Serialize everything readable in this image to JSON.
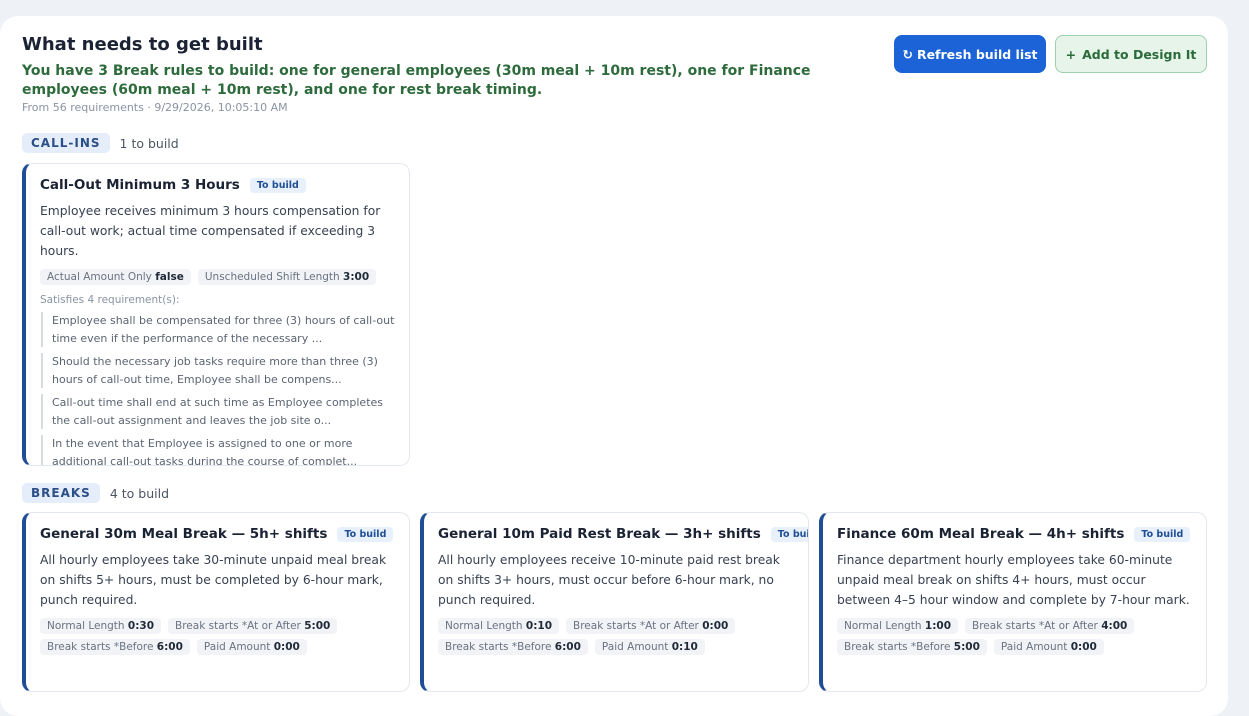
{
  "header": {
    "title": "What needs to get built",
    "summary": "You have 3 Break rules to build: one for general employees (30m meal + 10m rest), one for Finance employees (60m meal + 10m rest), and one for rest break timing.",
    "meta": "From 56 requirements · 9/29/2026, 10:05:10 AM",
    "refresh_label": "Refresh build list",
    "add_label": "Add to Design It",
    "refresh_icon": "↻",
    "add_icon": "+"
  },
  "sections": [
    {
      "tag": "CALL-INS",
      "count": "1 to build",
      "cards": [
        {
          "title": "Call-Out Minimum 3 Hours",
          "badge": "To build",
          "description": "Employee receives minimum 3 hours compensation for call-out work; actual time compensated if exceeding 3 hours.",
          "chips": [
            {
              "label": "Actual Amount Only",
              "value": "false"
            },
            {
              "label": "Unscheduled Shift Length",
              "value": "3:00"
            }
          ],
          "satisfies": "Satisfies 4 requirement(s):",
          "requirements": [
            "Employee shall be compensated for three (3) hours of call-out time even if the performance of the necessary ...",
            "Should the necessary job tasks require more than three (3) hours of call-out time, Employee shall be compens...",
            "Call-out time shall end at such time as Employee completes the call-out assignment and leaves the job site o...",
            "In the event that Employee is assigned to one or more additional call-out tasks during the course of complet..."
          ]
        }
      ]
    },
    {
      "tag": "BREAKS",
      "count": "4 to build",
      "cards": [
        {
          "title": "General 30m Meal Break — 5h+ shifts",
          "badge": "To build",
          "description": "All hourly employees take 30-minute unpaid meal break on shifts 5+ hours, must be completed by 6-hour mark, punch required.",
          "chips": [
            {
              "label": "Normal Length",
              "value": "0:30"
            },
            {
              "label": "Break starts *At or After",
              "value": "5:00"
            },
            {
              "label": "Break starts *Before",
              "value": "6:00"
            },
            {
              "label": "Paid Amount",
              "value": "0:00"
            }
          ]
        },
        {
          "title": "General 10m Paid Rest Break — 3h+ shifts",
          "badge": "To build",
          "description": "All hourly employees receive 10-minute paid rest break on shifts 3+ hours, must occur before 6-hour mark, no punch required.",
          "chips": [
            {
              "label": "Normal Length",
              "value": "0:10"
            },
            {
              "label": "Break starts *At or After",
              "value": "0:00"
            },
            {
              "label": "Break starts *Before",
              "value": "6:00"
            },
            {
              "label": "Paid Amount",
              "value": "0:10"
            }
          ]
        },
        {
          "title": "Finance 60m Meal Break — 4h+ shifts",
          "badge": "To build",
          "description": "Finance department hourly employees take 60-minute unpaid meal break on shifts 4+ hours, must occur between 4–5 hour window and complete by 7-hour mark.",
          "chips": [
            {
              "label": "Normal Length",
              "value": "1:00"
            },
            {
              "label": "Break starts *At or After",
              "value": "4:00"
            },
            {
              "label": "Break starts *Before",
              "value": "5:00"
            },
            {
              "label": "Paid Amount",
              "value": "0:00"
            }
          ]
        }
      ]
    }
  ]
}
